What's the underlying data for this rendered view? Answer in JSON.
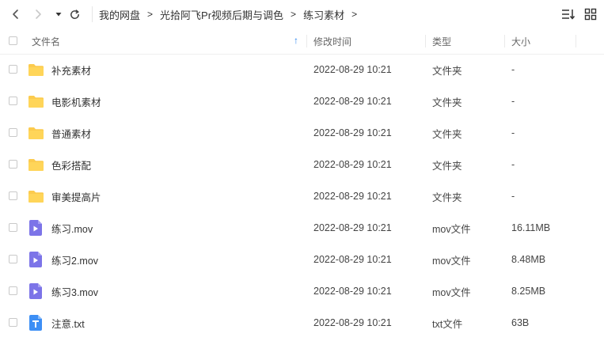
{
  "breadcrumb": [
    "我的网盘",
    "光拾阿飞Pr视频后期与调色",
    "练习素材"
  ],
  "columns": {
    "name": "文件名",
    "modified": "修改时间",
    "type": "类型",
    "size": "大小"
  },
  "sort": {
    "column": "name",
    "direction": "asc",
    "arrow": "↑"
  },
  "colors": {
    "accent": "#2b86f0",
    "folder": "#fccb4e",
    "video": "#7c74e8",
    "text_file": "#3d8ff5"
  },
  "files": [
    {
      "name": "补充素材",
      "modified": "2022-08-29 10:21",
      "type": "文件夹",
      "size": "-",
      "icon": "folder-icon"
    },
    {
      "name": "电影机素材",
      "modified": "2022-08-29 10:21",
      "type": "文件夹",
      "size": "-",
      "icon": "folder-icon"
    },
    {
      "name": "普通素材",
      "modified": "2022-08-29 10:21",
      "type": "文件夹",
      "size": "-",
      "icon": "folder-icon"
    },
    {
      "name": "色彩搭配",
      "modified": "2022-08-29 10:21",
      "type": "文件夹",
      "size": "-",
      "icon": "folder-icon"
    },
    {
      "name": "审美提高片",
      "modified": "2022-08-29 10:21",
      "type": "文件夹",
      "size": "-",
      "icon": "folder-icon"
    },
    {
      "name": "练习.mov",
      "modified": "2022-08-29 10:21",
      "type": "mov文件",
      "size": "16.11MB",
      "icon": "video-file-icon"
    },
    {
      "name": "练习2.mov",
      "modified": "2022-08-29 10:21",
      "type": "mov文件",
      "size": "8.48MB",
      "icon": "video-file-icon"
    },
    {
      "name": "练习3.mov",
      "modified": "2022-08-29 10:21",
      "type": "mov文件",
      "size": "8.25MB",
      "icon": "video-file-icon"
    },
    {
      "name": "注意.txt",
      "modified": "2022-08-29 10:21",
      "type": "txt文件",
      "size": "63B",
      "icon": "text-file-icon"
    }
  ]
}
